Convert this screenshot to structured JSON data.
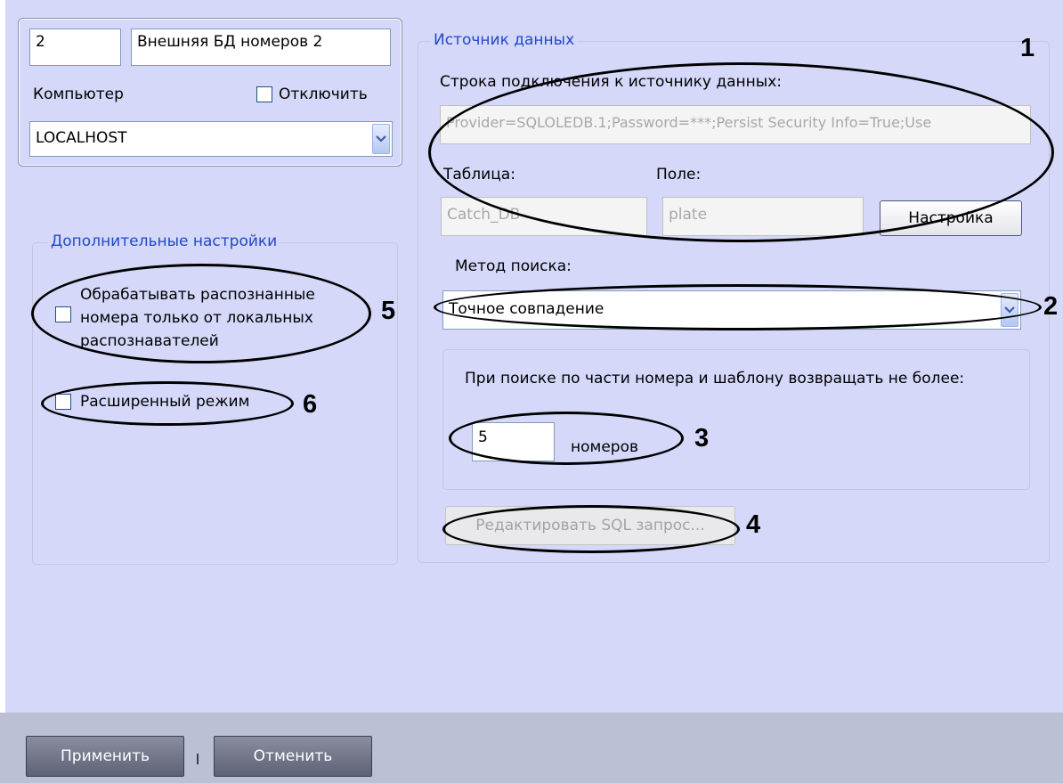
{
  "object": {
    "id": "2",
    "name": "Внешняя БД номеров 2",
    "computer_label": "Компьютер",
    "disable_label": "Отключить",
    "computer_value": "LOCALHOST"
  },
  "datasource": {
    "legend": "Источник данных",
    "connection_label": "Строка подключения к источнику данных:",
    "connection_value": "Provider=SQLOLEDB.1;Password=***;Persist Security Info=True;Use",
    "table_label": "Таблица:",
    "field_label": "Поле:",
    "table_value": "Catch_DB",
    "field_value": "plate",
    "setup_button": "Настройка",
    "search_method_label": "Метод поиска:",
    "search_method_value": "Точное совпадение",
    "limit_text": "При поиске по части номера и шаблону возвращать не более:",
    "limit_value": "5",
    "limit_unit": "номеров",
    "edit_sql_button": "Редактировать SQL запрос..."
  },
  "extra": {
    "legend": "Дополнительные настройки",
    "local_only_label": "Обрабатывать распознанные номера только от локальных распознавателей",
    "extended_mode_label": "Расширенный режим"
  },
  "callouts": [
    "1",
    "2",
    "3",
    "4",
    "5",
    "6"
  ],
  "footer": {
    "apply": "Применить",
    "cancel": "Отменить"
  }
}
